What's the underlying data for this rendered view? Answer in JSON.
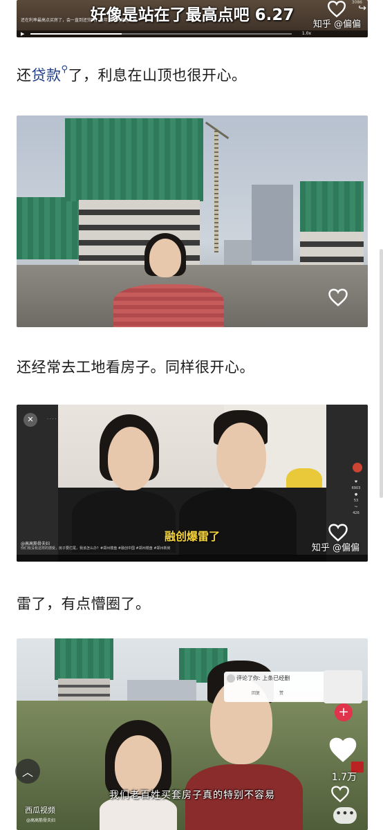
{
  "frame1": {
    "caption": "好像是站在了最高点吧 6.27",
    "tiny_line1": "还在利率最高点买房了，会一直到还完吗，每年还有利息这么高",
    "watermark": "知乎 @偏偏",
    "speed": "1.0x",
    "count": "3086"
  },
  "paragraph1": {
    "before": "还",
    "link": "贷款",
    "after": "了，利息在山顶也很开心。"
  },
  "paragraph2": "还经常去工地看房子。同样很开心。",
  "frame3": {
    "subtitle": "融创爆雷了",
    "account": "@高高筋骨夫妇",
    "description": "你们有没有这样的感受，房子要烂尾，我该怎么办？#郑州楼盘 #融创中国 #郑州楼盘 #郑州新房",
    "watermark": "知乎 @偏偏",
    "side_counts": [
      "6903",
      "53",
      "426"
    ]
  },
  "paragraph3": "雷了，有点懵圈了。",
  "frame4": {
    "subtitle": "我们老百姓买套房子真的特别不容易",
    "popup_title": "评论了你: 上条已经删",
    "popup_reply": "回复",
    "popup_like": "赞",
    "likes": "1.7万",
    "platform": "西瓜视频",
    "platform_sub": "@高高筋骨夫妇"
  },
  "colors": {
    "link": "#1f3c88",
    "subtitle_yellow": "#f3d13a",
    "plus_red": "#e0334c"
  }
}
